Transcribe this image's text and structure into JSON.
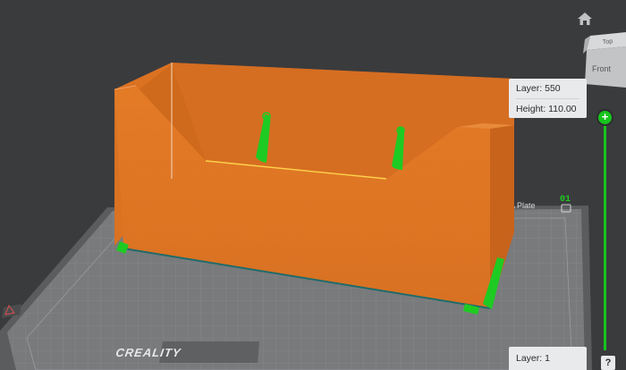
{
  "colors": {
    "background": "#3a3b3d",
    "print_object": "#e27a2a",
    "support": "#1ecb22",
    "plate": "#757779",
    "accent": "#16c41c"
  },
  "plate": {
    "brand": "CREALITY",
    "plate_label": "A Plate",
    "plate_number": "01",
    "plate_icon": "plate-icon"
  },
  "view_cube": {
    "top_label": "Top",
    "front_label": "Front"
  },
  "layer_slider": {
    "top_layer_label": "Layer: 550",
    "top_height_label": "Height: 110.00",
    "bottom_layer_label": "Layer: 1",
    "handle_symbol": "+",
    "current_layer": 550,
    "min_layer": 1
  },
  "toolbar": {
    "home_icon": "home-icon",
    "help_label": "?"
  }
}
